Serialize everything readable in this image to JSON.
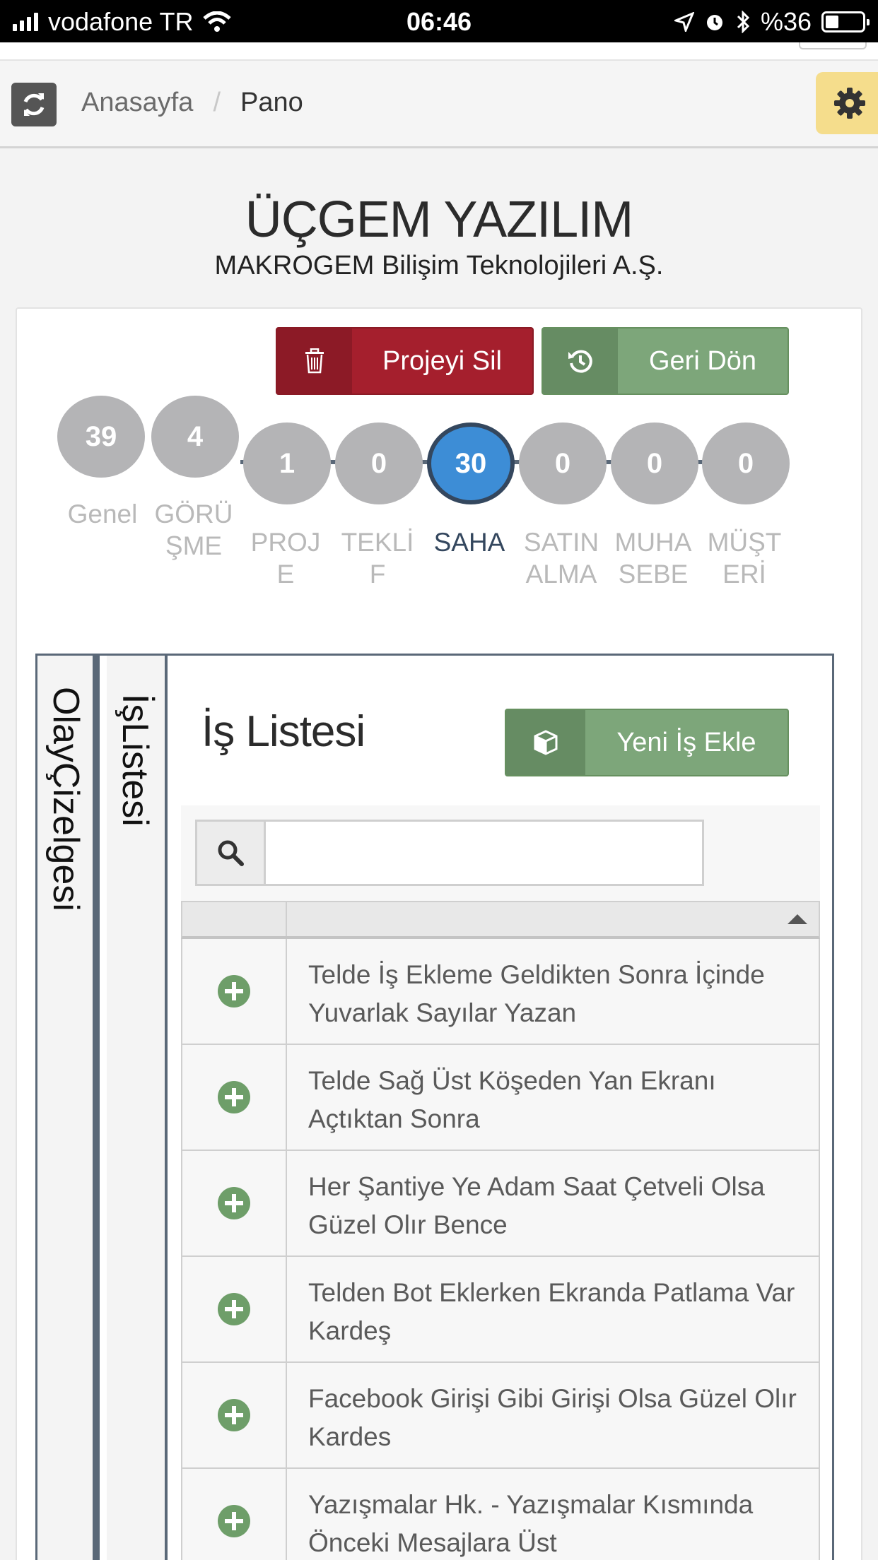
{
  "status_bar": {
    "carrier": "vodafone TR",
    "time": "06:46",
    "battery": "%36",
    "battery_level": 0.36,
    "icons": [
      "signal-icon",
      "wifi-icon",
      "location-arrow-icon",
      "alarm-icon",
      "bluetooth-icon",
      "battery-icon"
    ]
  },
  "breadcrumb": {
    "home": "Anasayfa",
    "separator": "/",
    "current": "Pano"
  },
  "header": {
    "title": "ÜÇGEM YAZILIM",
    "subtitle": "MAKROGEM Bilişim Teknolojileri A.Ş."
  },
  "actions": {
    "delete_label": "Projeyi Sil",
    "back_label": "Geri Dön"
  },
  "steps": [
    {
      "count": "39",
      "label": "Genel"
    },
    {
      "count": "4",
      "label": "GÖRÜ\nŞME"
    },
    {
      "count": "1",
      "label": "PROJ\nE"
    },
    {
      "count": "0",
      "label": "TEKLİ\nF"
    },
    {
      "count": "30",
      "label": "SAHA",
      "active": true
    },
    {
      "count": "0",
      "label": "SATIN\nALMA"
    },
    {
      "count": "0",
      "label": "MUHA\nSEBE"
    },
    {
      "count": "0",
      "label": "MÜŞT\nERİ"
    }
  ],
  "side_tabs": [
    "OlayÇizelgesi",
    "İşListesi"
  ],
  "work_list": {
    "title": "İş Listesi",
    "new_button": "Yeni İş Ekle",
    "search_value": "",
    "rows": [
      "Telde İş Ekleme Geldikten Sonra İçinde Yuvarlak Sayılar Yazan",
      "Telde Sağ Üst Köşeden Yan Ekranı Açtıktan Sonra",
      "Her Şantiye Ye Adam Saat Çetveli Olsa Güzel Olır Bence",
      "Telden Bot Eklerken Ekranda Patlama Var Kardeş",
      "Facebook Girişi Gibi Girişi Olsa Güzel Olır Kardes",
      "Yazışmalar Hk. - Yazışmalar Kısmında Önceki Mesajlara Üst"
    ]
  },
  "colors": {
    "danger": "#a51f2d",
    "success": "#7da67a",
    "active_step": "#3d8dd6",
    "inactive_step": "#b4b4b6",
    "settings": "#f5dd8c"
  }
}
